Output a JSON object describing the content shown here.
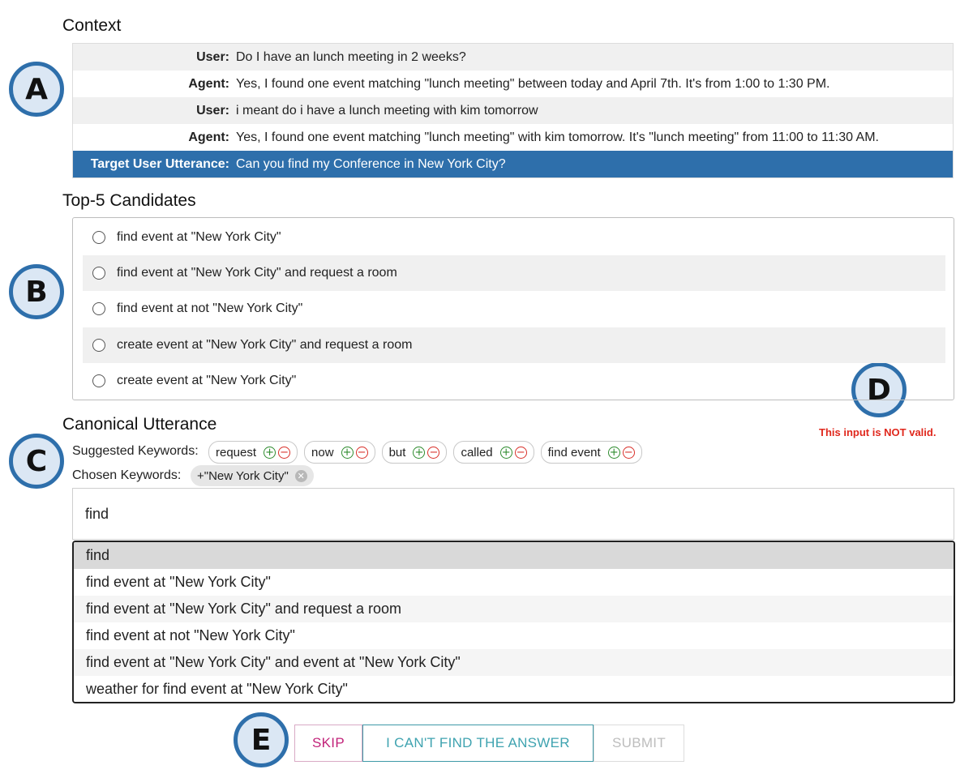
{
  "headings": {
    "context": "Context",
    "candidates": "Top-5 Candidates",
    "canonical": "Canonical Utterance"
  },
  "badges": {
    "a": "A",
    "b": "B",
    "c": "C",
    "d": "D",
    "e": "E"
  },
  "context": {
    "rows": [
      {
        "role": "User:",
        "text": "Do I have an lunch meeting in 2 weeks?"
      },
      {
        "role": "Agent:",
        "text": "Yes, I found one event matching \"lunch meeting\" between today and April 7th. It's from 1:00 to 1:30 PM."
      },
      {
        "role": "User:",
        "text": "i meant do i have a lunch meeting with kim tomorrow"
      },
      {
        "role": "Agent:",
        "text": "Yes, I found one event matching \"lunch meeting\" with kim tomorrow. It's \"lunch meeting\" from 11:00 to 11:30 AM."
      }
    ],
    "target": {
      "role": "Target User Utterance:",
      "text": "Can you find my Conference in New York City?"
    }
  },
  "candidates": [
    "find event at \"New York City\"",
    "find event at \"New York City\" and request a room",
    "find event at not \"New York City\"",
    "create event at \"New York City\" and request a room",
    "create event at \"New York City\""
  ],
  "validation": {
    "message": "This input is NOT valid."
  },
  "keywords": {
    "suggested_label": "Suggested Keywords:",
    "suggested": [
      "request",
      "now",
      "but",
      "called",
      "find event"
    ],
    "chosen_label": "Chosen Keywords:",
    "chosen": [
      "+\"New York City\""
    ]
  },
  "input": {
    "value": "find"
  },
  "suggestions": {
    "active_index": 0,
    "items": [
      "find",
      "find event at \"New York City\"",
      "find event at \"New York City\" and request a room",
      "find event at not \"New York City\"",
      "find event at \"New York City\" and event at \"New York City\"",
      "weather for find event at \"New York City\""
    ]
  },
  "buttons": {
    "skip": "SKIP",
    "cant_find": "I CAN'T FIND THE ANSWER",
    "submit": "SUBMIT"
  },
  "colors": {
    "accent_blue": "#2e6fab",
    "error_red": "#e0281d",
    "skip_magenta": "#c2237a",
    "cant_teal": "#3fa3b0",
    "plus_green": "#2e8b2e",
    "minus_red": "#d9302a"
  },
  "icons": {
    "radio": "radio-unchecked-icon",
    "plus": "plus-circle-icon",
    "minus": "minus-circle-icon",
    "remove": "close-circle-icon"
  }
}
